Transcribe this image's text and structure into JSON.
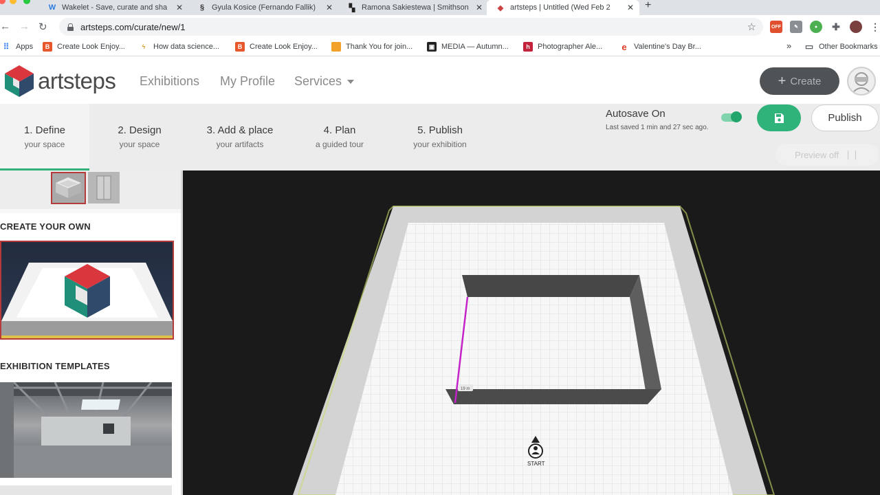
{
  "browser": {
    "tabs": [
      {
        "title": "Wakelet - Save, curate and sha",
        "favicon": "W",
        "color": "#2d7de1"
      },
      {
        "title": "Gyula Kosice (Fernando Fallik)",
        "favicon": "§",
        "color": "#333333"
      },
      {
        "title": "Ramona Sakiestewa | Smithson",
        "favicon": "▚",
        "color": "#222222"
      },
      {
        "title": "artsteps | Untitled (Wed Feb 2",
        "favicon": "◆",
        "color": "#c44"
      }
    ],
    "close_glyph": "✕",
    "new_tab": "+",
    "url": "artsteps.com/curate/new/1",
    "bookmarks": [
      {
        "label": "Apps",
        "color": "#4285f4"
      },
      {
        "label": "Create Look Enjoy...",
        "color": "#e8572c"
      },
      {
        "label": "How data science...",
        "color": "#d89a2b"
      },
      {
        "label": "Create Look Enjoy...",
        "color": "#e8572c"
      },
      {
        "label": "Thank You for join...",
        "color": "#f2a22a"
      },
      {
        "label": "MEDIA — Autumn...",
        "color": "#222222"
      },
      {
        "label": "Photographer Ale...",
        "color": "#c4213b"
      },
      {
        "label": "Valentine's Day Br...",
        "color": "#e03c28"
      }
    ],
    "bookmarks_more": "»",
    "other_bookmarks": "Other Bookmarks",
    "ext_off_badge": "OFF"
  },
  "app": {
    "brand": "artsteps",
    "nav": {
      "exhibitions": "Exhibitions",
      "my_profile": "My Profile",
      "services": "Services"
    },
    "create_label": "Create",
    "accent": "#2fb37a"
  },
  "steps": [
    {
      "title": "1. Define",
      "subtitle": "your space"
    },
    {
      "title": "2. Design",
      "subtitle": "your space"
    },
    {
      "title": "3. Add & place",
      "subtitle": "your artifacts"
    },
    {
      "title": "4. Plan",
      "subtitle": "a guided tour"
    },
    {
      "title": "5. Publish",
      "subtitle": "your exhibition"
    }
  ],
  "status": {
    "autosave": "Autosave On",
    "last_saved": "Last saved 1 min and 27 sec ago.",
    "autosave_enabled": true,
    "publish": "Publish",
    "preview": "Preview off"
  },
  "sidebar": {
    "create_your_own": "CREATE YOUR OWN",
    "exhibition_templates": "EXHIBITION TEMPLATES"
  },
  "viewport": {
    "wall_label": "19 m",
    "start_label": "START"
  }
}
